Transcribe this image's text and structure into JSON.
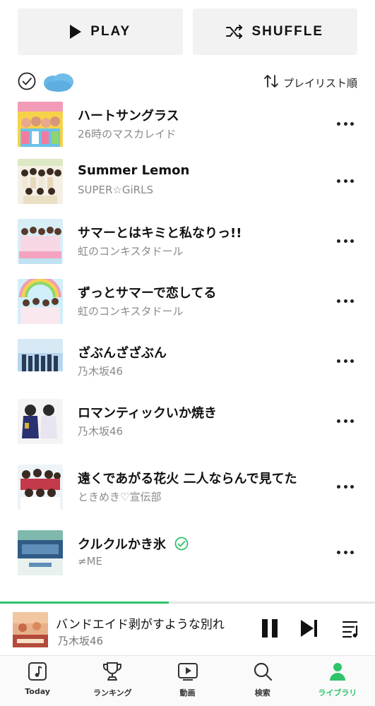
{
  "actions": {
    "play_label": "PLAY",
    "shuffle_label": "SHUFFLE"
  },
  "list_header": {
    "sort_label": "プレイリスト順"
  },
  "tracks": [
    {
      "title": "ハートサングラス",
      "artist": "26時のマスカレイド",
      "verified": false
    },
    {
      "title": "Summer Lemon",
      "artist": "SUPER☆GiRLS",
      "verified": false
    },
    {
      "title": "サマーとはキミと私なりっ!!",
      "artist": "虹のコンキスタドール",
      "verified": false
    },
    {
      "title": "ずっとサマーで恋してる",
      "artist": "虹のコンキスタドール",
      "verified": false
    },
    {
      "title": "ざぶんざざぶん",
      "artist": "乃木坂46",
      "verified": false
    },
    {
      "title": "ロマンティックいか焼き",
      "artist": "乃木坂46",
      "verified": false
    },
    {
      "title": "遠くであがる花火 二人ならんで見てた",
      "artist": "ときめき♡宣伝部",
      "verified": false
    },
    {
      "title": "クルクルかき氷",
      "artist": "≠ME",
      "verified": true
    }
  ],
  "now_playing": {
    "title": "バンドエイド剥がすような別れ",
    "artist": "乃木坂46",
    "progress": 0.45
  },
  "tabs": [
    {
      "label": "Today",
      "icon": "music-note-icon"
    },
    {
      "label": "ランキング",
      "icon": "trophy-icon"
    },
    {
      "label": "動画",
      "icon": "video-icon"
    },
    {
      "label": "検索",
      "icon": "search-icon"
    },
    {
      "label": "ライブラリ",
      "icon": "library-icon"
    }
  ],
  "colors": {
    "accent": "#2fc46a",
    "button_bg": "#f2f2f2",
    "secondary_text": "#8a8a8a"
  }
}
